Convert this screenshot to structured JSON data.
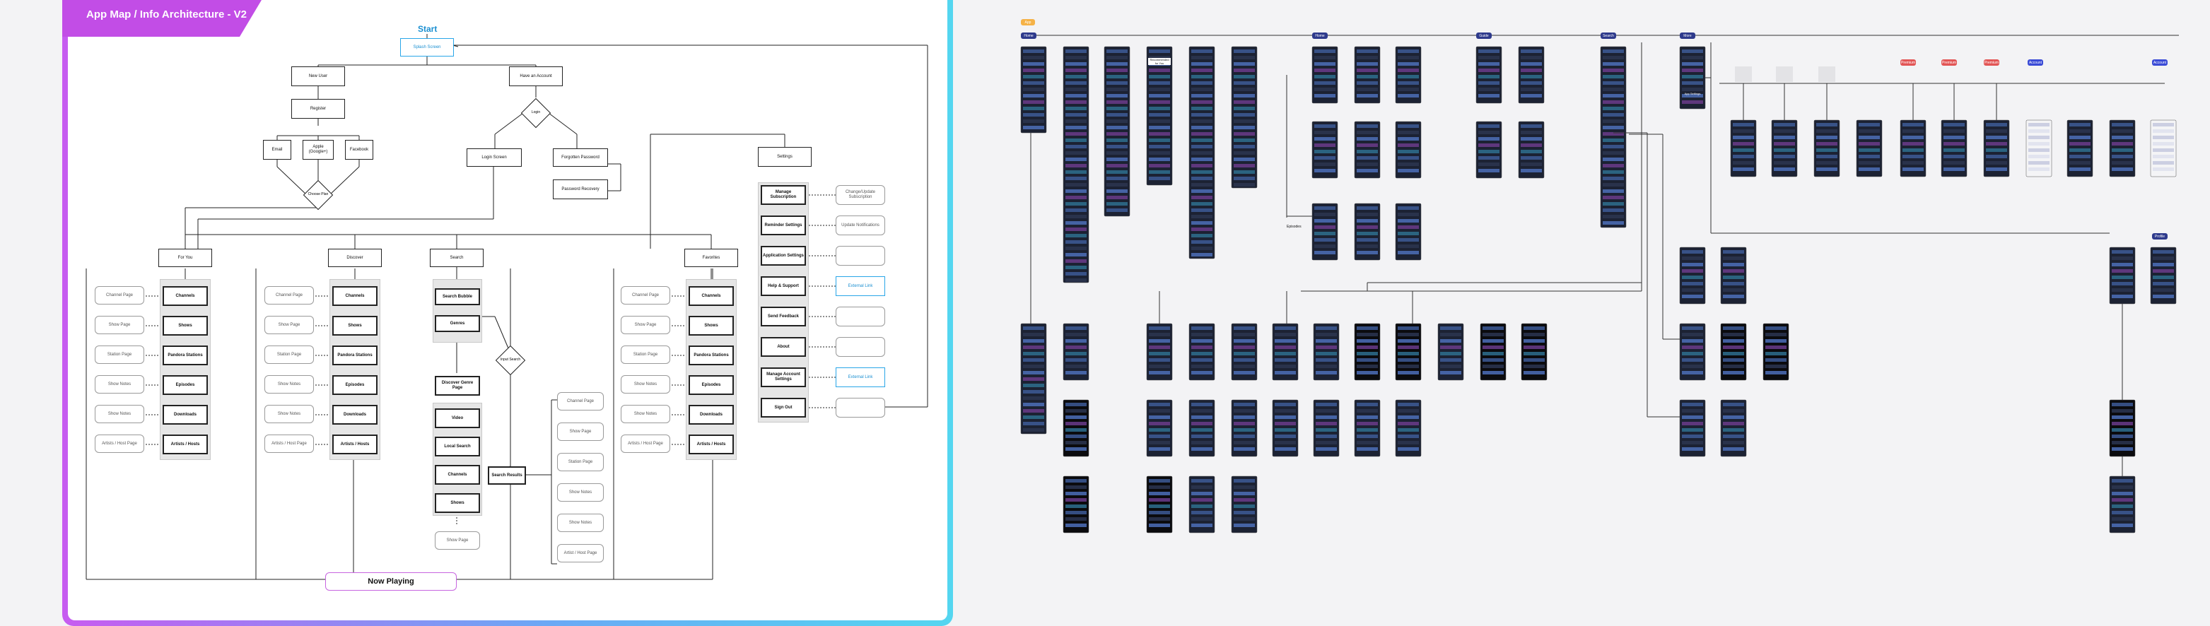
{
  "title": "App Map / Info Architecture - V2",
  "start": "Start",
  "main": {
    "splash": "Splash Screen",
    "new_user": "New User",
    "have_account": "Have an Account",
    "register": "Register",
    "email": "Email",
    "apple_google": "Apple (Google+)",
    "facebook": "Facebook",
    "choose_plan": "Choose Plan",
    "login": "Login",
    "login_screen": "Login Screen",
    "forgotten_password": "Forgotten Password",
    "password_recovery": "Password Recovery",
    "settings": "Settings",
    "now_playing": "Now Playing"
  },
  "columns": {
    "for_you": "For You",
    "discover": "Discover",
    "search": "Search",
    "favorites": "Favorites"
  },
  "content_items": [
    "Channels",
    "Shows",
    "Pandora Stations",
    "Episodes",
    "Downloads",
    "Artists / Hosts"
  ],
  "content_pages": [
    "Channel Page",
    "Show Page",
    "Station Page",
    "Show Notes",
    "Show Notes",
    "Artists / Host Page"
  ],
  "search_items": {
    "search_bubble": "Search Bubble",
    "genres": "Genres",
    "input_search": "Input Search",
    "discover_genre": "Discover Genre Page",
    "results": [
      "Video",
      "Local Search",
      "Channels",
      "Shows"
    ],
    "show_page": "Show Page",
    "search_results": "Search Results",
    "result_pages": [
      "Channel Page",
      "Show Page",
      "Station Page",
      "Show Notes",
      "Show Notes",
      "Artist / Host Page"
    ]
  },
  "settings_items": [
    "Manage Subscription",
    "Reminder Settings",
    "Application Settings",
    "Help & Support",
    "Send Feedback",
    "About",
    "Manage Account Settings",
    "Sign Out"
  ],
  "settings_links": [
    "Change/Update Subscription",
    "Update Notifications",
    "",
    "External Link",
    "",
    "",
    "External Link",
    ""
  ],
  "right_canvas": {
    "tag": "App",
    "section_tabs": [
      "Home",
      "Home",
      "Guide",
      "Search",
      "More",
      "Profile"
    ],
    "red_tags": [
      "Premium",
      "Premium",
      "Premium"
    ],
    "blue_tags": [
      "Account",
      "Account"
    ],
    "card_texts": [
      "Recommended for You",
      "App Settings"
    ],
    "sub_label": "Episodes"
  },
  "colors": {
    "accent_purple": "#c24de6",
    "gradient_blue": "#54d6f0",
    "link_blue": "#1a8fd1",
    "screen_dark": "#1c2233",
    "tag_orange": "#f5b247",
    "tag_navy": "#2e3a8c"
  }
}
